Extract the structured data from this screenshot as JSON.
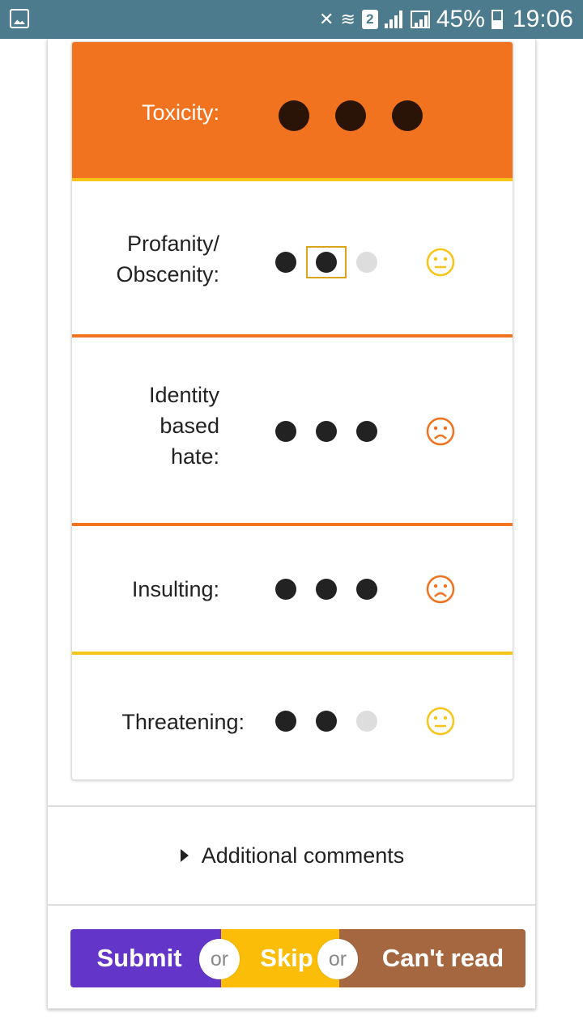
{
  "status_bar": {
    "sim_label": "2",
    "battery_pct": "45%",
    "time": "19:06"
  },
  "ratings": [
    {
      "label": "Toxicity:",
      "level": 3,
      "max": 3
    },
    {
      "label_lines": [
        "Profanity/",
        "Obscenity:"
      ],
      "level": 2,
      "max": 3,
      "face": "neutral-face-icon",
      "face_color": "#f5c518"
    },
    {
      "label_lines": [
        "Identity",
        "based",
        "hate:"
      ],
      "level": 3,
      "max": 3,
      "face": "frown-face-icon",
      "face_color": "#f2731f"
    },
    {
      "label": "Insulting:",
      "level": 3,
      "max": 3,
      "face": "frown-face-icon",
      "face_color": "#f2731f"
    },
    {
      "label": "Threatening:",
      "level": 2,
      "max": 3,
      "face": "neutral-face-icon",
      "face_color": "#f5c518"
    }
  ],
  "comments": {
    "label": "Additional comments"
  },
  "actions": {
    "submit": "Submit",
    "or1": "or",
    "skip": "Skip",
    "or2": "or",
    "cant_read": "Can't read"
  },
  "colors": {
    "toxicity_bg": "#f2731f",
    "submit": "#6435c9",
    "skip": "#fbbd08",
    "cant_read": "#a5673f",
    "status_bar": "#4c7b8e"
  }
}
